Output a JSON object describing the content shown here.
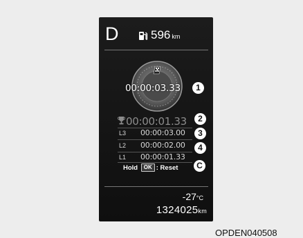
{
  "cluster": {
    "gear": "D",
    "range_value": "596",
    "range_unit": "km"
  },
  "laptimer": {
    "current_time": "00:00:03.33",
    "best_time": "00:00:01.33",
    "laps": [
      {
        "label": "L3",
        "time": "00:00:03.00"
      },
      {
        "label": "L2",
        "time": "00:00:02.00"
      },
      {
        "label": "L1",
        "time": "00:00:01.33"
      }
    ],
    "hold_text": "Hold",
    "ok_button": "OK",
    "reset_text": ": Reset"
  },
  "callouts": {
    "c1": "1",
    "c2": "2",
    "c3": "3",
    "c4": "4",
    "cc": "C"
  },
  "status": {
    "temperature_value": "-27",
    "temperature_unit": "°C",
    "odometer_value": "1324025",
    "odometer_unit": "km"
  },
  "figure_code": "OPDEN040508"
}
